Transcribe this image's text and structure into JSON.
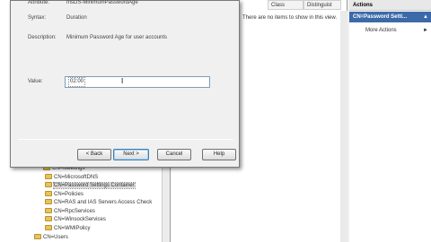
{
  "dialog": {
    "attribute_label": "Attribute:",
    "attribute_value": "msDS-MinimumPasswordAge",
    "syntax_label": "Syntax:",
    "syntax_value": "Duration",
    "description_label": "Description:",
    "description_value": "Minimum Password Age for user accounts",
    "value_label": "Value:",
    "value": "02:00",
    "buttons": {
      "back": "< Back",
      "next": "Next >",
      "cancel": "Cancel",
      "help": "Help"
    }
  },
  "tree": {
    "items": [
      "CN=Meetings",
      "CN=MicrosoftDNS",
      "CN=Password Settings Container",
      "CN=Policies",
      "CN=RAS and IAS Servers Access Check",
      "CN=RpcServices",
      "CN=WinsockServices",
      "CN=WMIPolicy",
      "CN=Users"
    ],
    "selected": "CN=Password Settings Container"
  },
  "list": {
    "columns": [
      "Class",
      "Distinguist"
    ],
    "empty_message": "There are no items to show in this view."
  },
  "actions": {
    "title": "Actions",
    "section": "CN=Password Setti...",
    "items": [
      "More Actions"
    ]
  }
}
